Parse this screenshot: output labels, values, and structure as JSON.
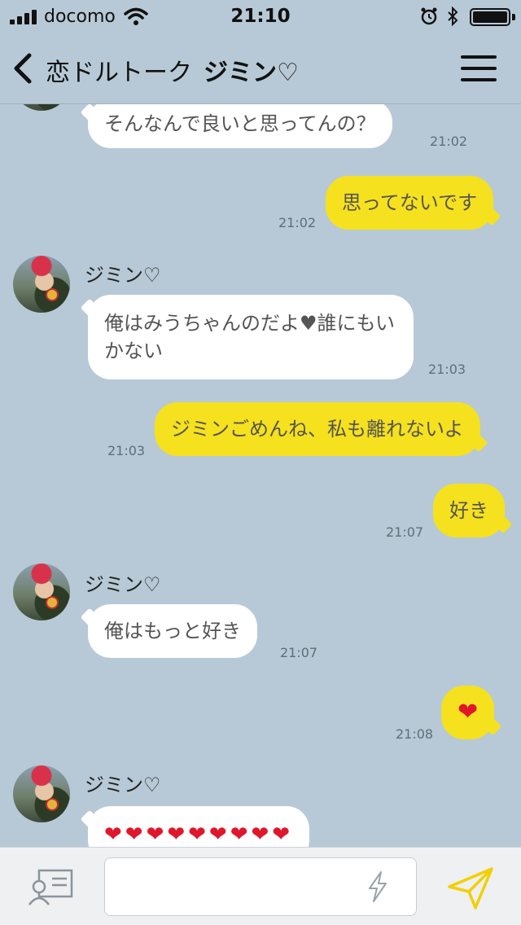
{
  "status_bar": {
    "carrier": "docomo",
    "time": "21:10",
    "icons": [
      "signal-icon",
      "wifi-icon",
      "alarm-icon",
      "bluetooth-icon",
      "battery-icon"
    ],
    "battery_level": 1.0
  },
  "header": {
    "app_name": "恋ドルトーク",
    "contact_name": "ジミン♡",
    "icons": [
      "back-icon",
      "menu-icon"
    ]
  },
  "messages": [
    {
      "side": "in",
      "text": "そんなんで良いと思ってんの？",
      "time": "21:02"
    },
    {
      "side": "out",
      "text": "思ってないです",
      "time": "21:02"
    },
    {
      "side": "in",
      "sender": "ジミン♡",
      "text": "俺はみうちゃんのだよ♥誰にもいかない",
      "line1": "俺はみうちゃんのだよ♥誰にもい",
      "line2": "かない",
      "time": "21:03"
    },
    {
      "side": "out",
      "text": "ジミンごめんね、私も離れないよ",
      "time": "21:03"
    },
    {
      "side": "out",
      "text": "好き",
      "time": "21:07"
    },
    {
      "side": "in",
      "sender": "ジミン♡",
      "text": "俺はもっと好き",
      "time": "21:07"
    },
    {
      "side": "out",
      "text": "❤",
      "time": "21:08"
    },
    {
      "side": "in",
      "sender": "ジミン♡",
      "text": "❤❤❤❤❤❤❤❤❤"
    }
  ],
  "input_bar": {
    "placeholder": "",
    "icons": [
      "contact-card-icon",
      "bolt-icon",
      "send-icon"
    ],
    "accent_color": "#f5d600"
  },
  "colors": {
    "background": "#b7c9d6",
    "bubble_out": "#f5e11e",
    "bubble_in": "#ffffff"
  }
}
